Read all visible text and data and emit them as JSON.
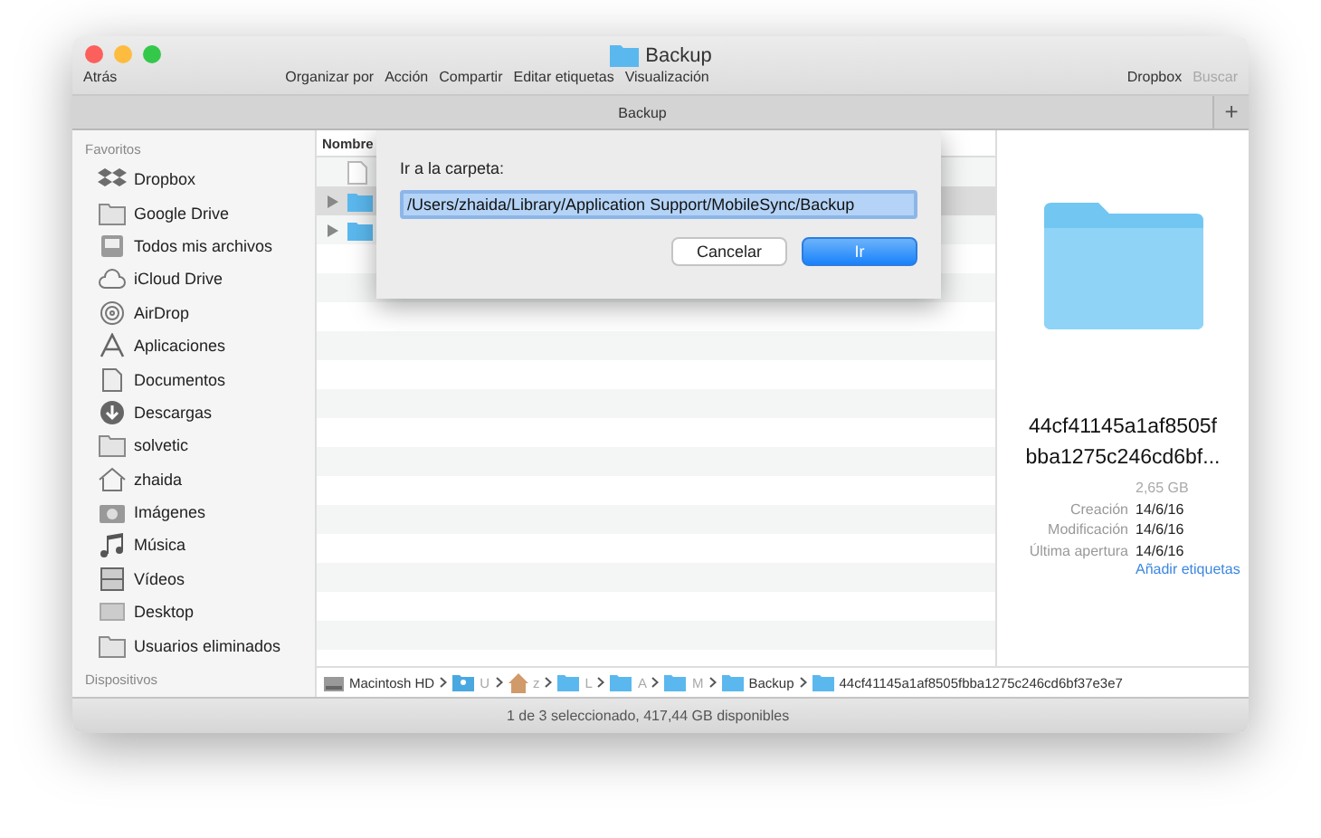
{
  "window": {
    "title": "Backup"
  },
  "toolbar": {
    "back": "Atrás",
    "items": [
      "Organizar por",
      "Acción",
      "Compartir",
      "Editar etiquetas",
      "Visualización"
    ],
    "right": [
      {
        "label": "Dropbox",
        "disabled": false
      },
      {
        "label": "Buscar",
        "disabled": true
      }
    ]
  },
  "tab": {
    "label": "Backup",
    "add": "+"
  },
  "sidebar": {
    "section": "Favoritos",
    "items": [
      {
        "kind": "dropbox",
        "label": "Dropbox"
      },
      {
        "kind": "folder",
        "label": "Google Drive"
      },
      {
        "kind": "stack",
        "label": "Todos mis archivos"
      },
      {
        "kind": "cloud",
        "label": "iCloud Drive"
      },
      {
        "kind": "airdrop",
        "label": "AirDrop"
      },
      {
        "kind": "apps",
        "label": "Aplicaciones"
      },
      {
        "kind": "doc",
        "label": "Documentos"
      },
      {
        "kind": "download",
        "label": "Descargas"
      },
      {
        "kind": "folder",
        "label": "solvetic"
      },
      {
        "kind": "home",
        "label": "zhaida"
      },
      {
        "kind": "camera",
        "label": "Imágenes"
      },
      {
        "kind": "music",
        "label": "Música"
      },
      {
        "kind": "film",
        "label": "Vídeos"
      },
      {
        "kind": "desktop",
        "label": "Desktop"
      },
      {
        "kind": "folder",
        "label": "Usuarios eliminados"
      }
    ],
    "section2": "Dispositivos"
  },
  "list": {
    "column": "Nombre",
    "rows": [
      {
        "kind": "file",
        "expandable": false,
        "selected": false
      },
      {
        "kind": "folder",
        "expandable": true,
        "selected": true
      },
      {
        "kind": "folder",
        "expandable": true,
        "selected": false
      }
    ]
  },
  "dialog": {
    "label": "Ir a la carpeta:",
    "value": "/Users/zhaida/Library/Application Support/MobileSync/Backup",
    "buttons": [
      {
        "label": "Cancelar",
        "default": false
      },
      {
        "label": "Ir",
        "default": true
      }
    ]
  },
  "preview": {
    "name_lines": [
      "44cf41145a1af8505f",
      "bba1275c246cd6bf..."
    ],
    "size": "2,65 GB",
    "details": [
      {
        "label": "Creación",
        "value": "14/6/16"
      },
      {
        "label": "Modificación",
        "value": "14/6/16"
      },
      {
        "label": "Última apertura",
        "value": "14/6/16"
      }
    ],
    "tags_link": "Añadir etiquetas"
  },
  "path": [
    {
      "kind": "disk",
      "label": "Macintosh HD"
    },
    {
      "kind": "users",
      "label": "U"
    },
    {
      "kind": "home",
      "label": "z"
    },
    {
      "kind": "folder",
      "label": "L"
    },
    {
      "kind": "folder",
      "label": "A"
    },
    {
      "kind": "folder",
      "label": "M"
    },
    {
      "kind": "folder",
      "label": "Backup"
    },
    {
      "kind": "folder",
      "label": "44cf41145a1af8505fbba1275c246cd6bf37e3e7"
    }
  ],
  "status": "1 de 3 seleccionado, 417,44 GB disponibles"
}
